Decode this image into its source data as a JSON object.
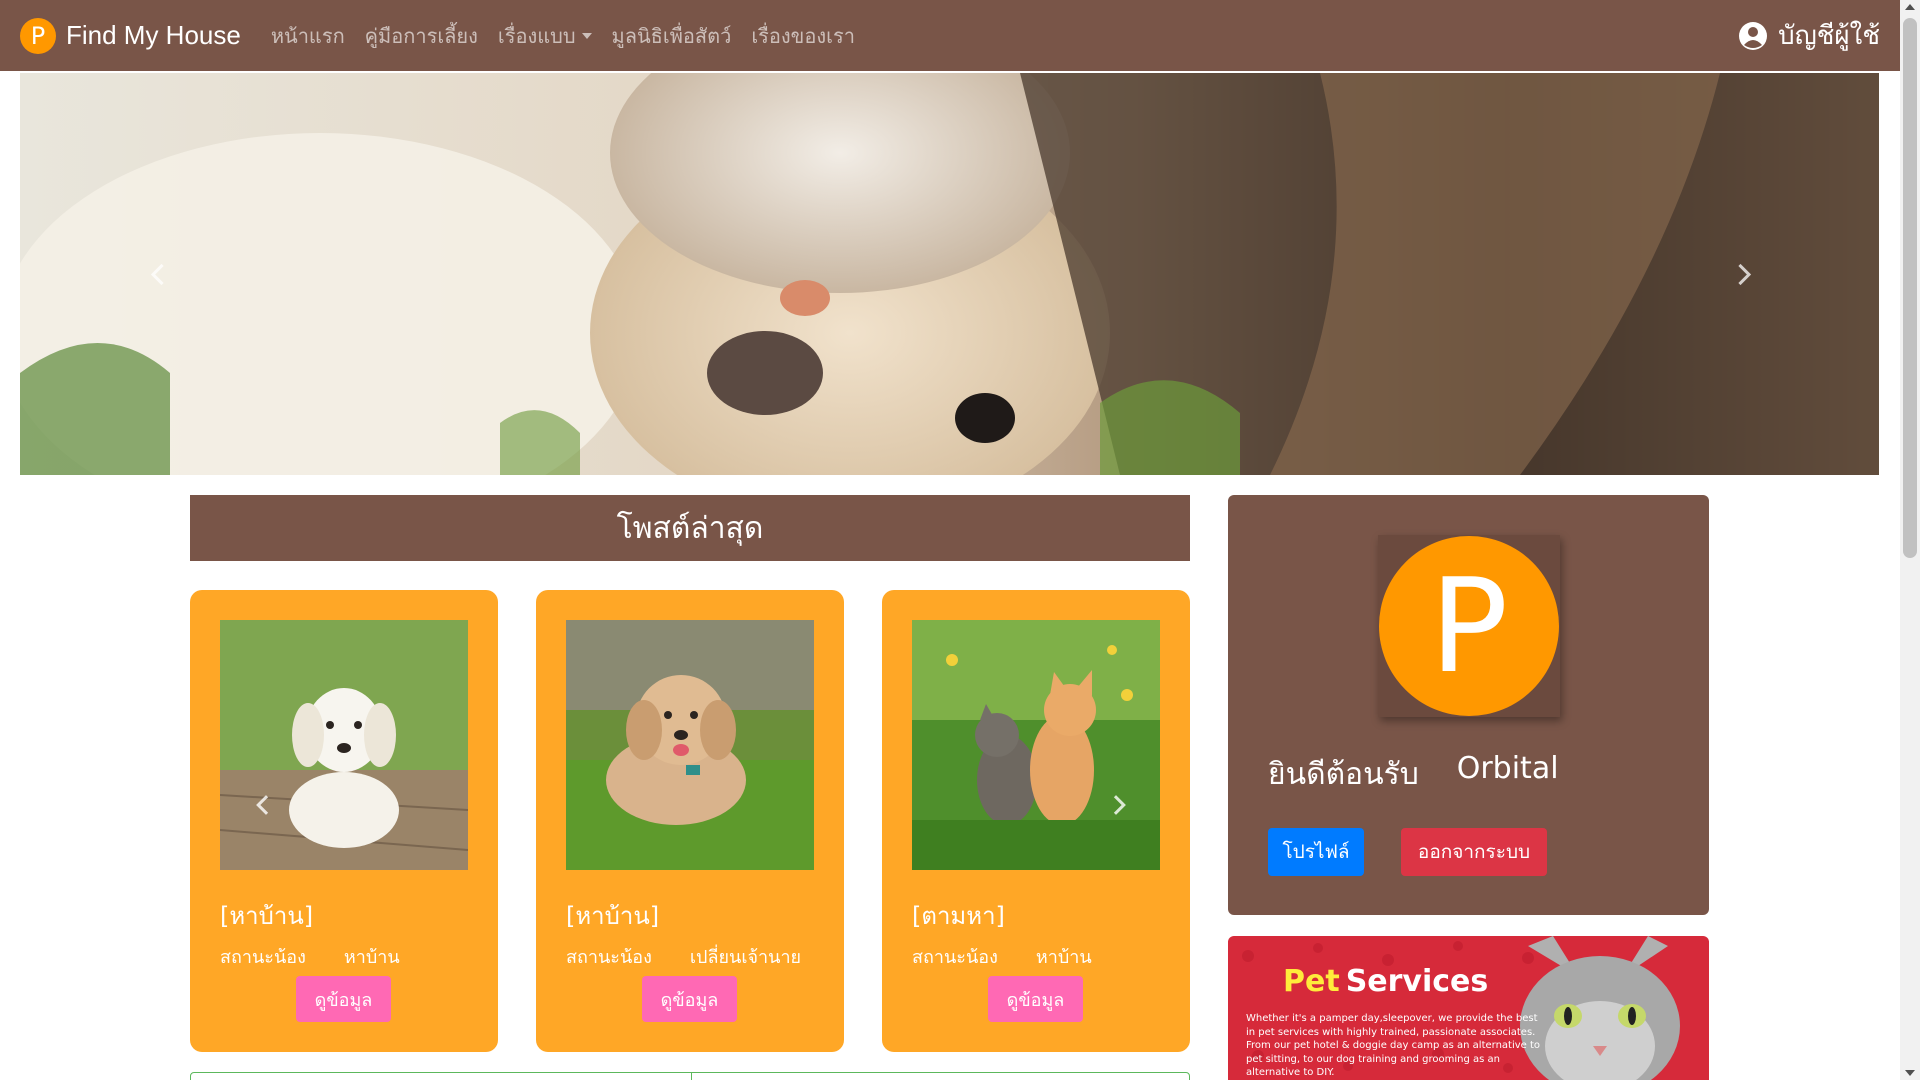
{
  "brand": {
    "logo_letter": "P",
    "name": "Find My House",
    "accent": "#ff9800"
  },
  "nav": {
    "items": [
      {
        "label": "หน้าแรก"
      },
      {
        "label": "คู่มือการเลี้ยง"
      },
      {
        "label": "เรื่องแบบ",
        "has_dropdown": true
      },
      {
        "label": "มูลนิธิเพื่อสัตว์"
      },
      {
        "label": "เรื่องของเรา"
      }
    ],
    "account_label": "บัญชีผู้ใช้",
    "account_icon": "user-circle-icon"
  },
  "hero": {
    "image": "cat-and-dog-photo"
  },
  "posts": {
    "header": "โพสต์ล่าสุด",
    "cards": [
      {
        "tag": "[หาบ้าน]",
        "status_label": "สถานะน้อง",
        "status_value": "หาบ้าน",
        "button": "ดูข้อมูล",
        "image": "white-puppy-photo"
      },
      {
        "tag": "[หาบ้าน]",
        "status_label": "สถานะน้อง",
        "status_value": "เปลี่ยนเจ้านาย",
        "button": "ดูข้อมูล",
        "image": "poodle-on-grass-photo"
      },
      {
        "tag": "[ตามหา]",
        "status_label": "สถานะน้อง",
        "status_value": "หาบ้าน",
        "button": "ดูข้อมูล",
        "image": "kittens-in-grass-photo"
      }
    ]
  },
  "profile": {
    "avatar_letter": "P",
    "welcome": "ยินดีต้อนรับ",
    "username": "Orbital",
    "profile_button": "โปรไฟล์",
    "logout_button": "ออกจากระบบ"
  },
  "ad": {
    "title_pet": "Pet",
    "title_services": "Services",
    "text": "Whether it's a pamper day,sleepover, we provide the best in pet services with highly trained, passionate associates. From our pet hotel & doggie day camp as an alternative to pet sitting, to our dog training and grooming as an alternative to DIY."
  },
  "colors": {
    "nav_bg": "#795548",
    "card_bg": "#ffa726",
    "view_button": "#ff69b4",
    "profile_button": "#007bff",
    "logout_button": "#dc3545"
  }
}
